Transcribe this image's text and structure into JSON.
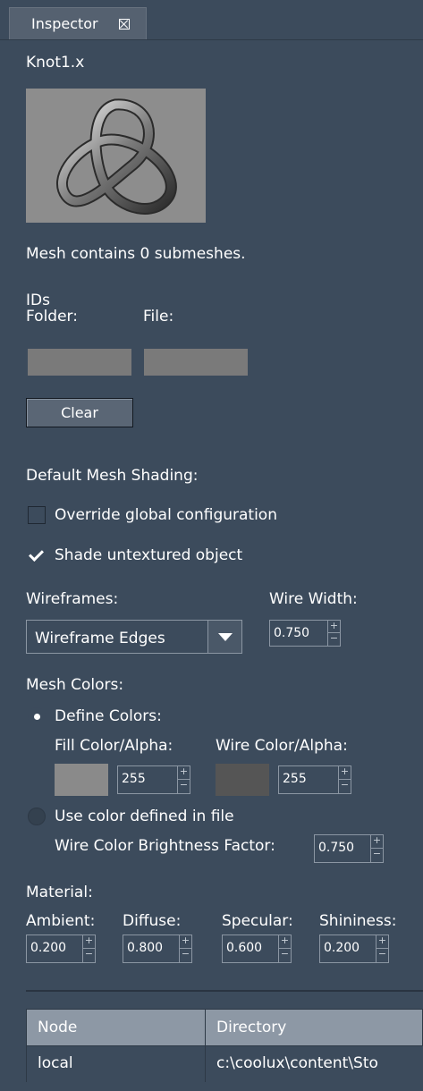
{
  "tab": {
    "label": "Inspector"
  },
  "header": {
    "filename": "Knot1.x"
  },
  "mesh": {
    "submesh_text": "Mesh contains 0 submeshes."
  },
  "ids": {
    "title": "IDs",
    "folder_label": "Folder:",
    "file_label": "File:",
    "folder_value": "",
    "file_value": "",
    "clear_label": "Clear"
  },
  "shading": {
    "title": "Default Mesh Shading:",
    "override_label": "Override global configuration",
    "override_checked": false,
    "shade_label": "Shade untextured object",
    "shade_checked": true
  },
  "wireframes": {
    "label": "Wireframes:",
    "selected": "Wireframe Edges",
    "width_label": "Wire Width:",
    "width_value": "0.750"
  },
  "mesh_colors": {
    "title": "Mesh Colors:",
    "define_label": "Define Colors:",
    "fill_label": "Fill Color/Alpha:",
    "wire_label": "Wire Color/Alpha:",
    "fill_alpha": "255",
    "wire_alpha": "255",
    "fill_color": "#8a8a8a",
    "wire_color": "#555555",
    "use_file_label": "Use color defined in file",
    "brightness_label": "Wire Color Brightness Factor:",
    "brightness_value": "0.750"
  },
  "material": {
    "title": "Material:",
    "ambient_label": "Ambient:",
    "diffuse_label": "Diffuse:",
    "specular_label": "Specular:",
    "shininess_label": "Shininess:",
    "ambient": "0.200",
    "diffuse": "0.800",
    "specular": "0.600",
    "shininess": "0.200"
  },
  "table": {
    "headers": [
      "Node",
      "Directory"
    ],
    "rows": [
      [
        "local",
        "c:\\coolux\\content\\Sto"
      ]
    ]
  },
  "icons": {
    "close": "close-icon",
    "dropdown": "chevron-down-icon",
    "check": "check-icon"
  },
  "colors": {
    "background": "#3c4b5c",
    "field": "#7a7a7a",
    "header": "#8d98a5"
  }
}
